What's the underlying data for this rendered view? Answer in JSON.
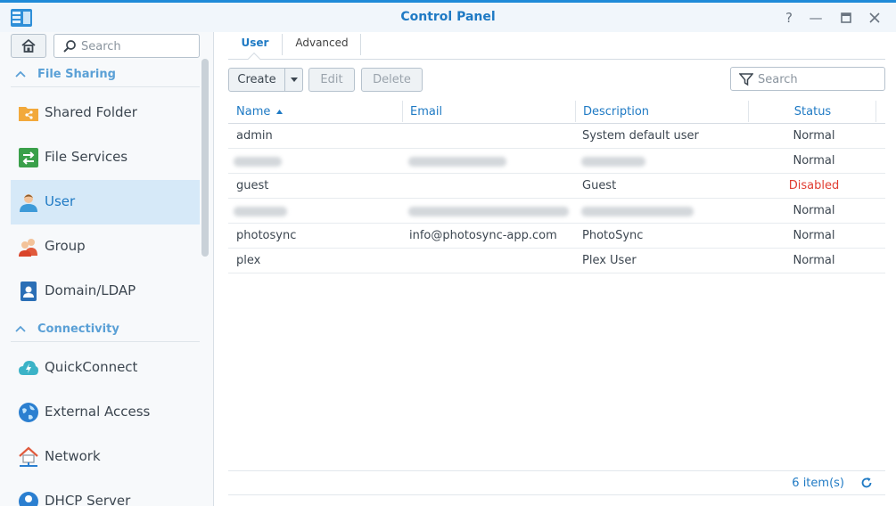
{
  "window": {
    "title": "Control Panel"
  },
  "sidebar": {
    "search_placeholder": "Search",
    "sections": [
      {
        "title": "File Sharing",
        "items": [
          {
            "label": "Shared Folder",
            "icon": "shared-folder-icon"
          },
          {
            "label": "File Services",
            "icon": "file-services-icon"
          },
          {
            "label": "User",
            "icon": "user-icon",
            "active": true
          },
          {
            "label": "Group",
            "icon": "group-icon"
          },
          {
            "label": "Domain/LDAP",
            "icon": "domain-ldap-icon"
          }
        ]
      },
      {
        "title": "Connectivity",
        "items": [
          {
            "label": "QuickConnect",
            "icon": "quickconnect-icon"
          },
          {
            "label": "External Access",
            "icon": "external-access-icon"
          },
          {
            "label": "Network",
            "icon": "network-icon"
          },
          {
            "label": "DHCP Server",
            "icon": "dhcp-server-icon"
          }
        ]
      }
    ]
  },
  "tabs": [
    {
      "label": "User",
      "active": true
    },
    {
      "label": "Advanced",
      "active": false
    }
  ],
  "toolbar": {
    "create_label": "Create",
    "edit_label": "Edit",
    "delete_label": "Delete",
    "search_placeholder": "Search"
  },
  "table": {
    "columns": [
      "Name",
      "Email",
      "Description",
      "Status"
    ],
    "sort_column": "Name",
    "sort_direction": "ascending",
    "rows": [
      {
        "name": "admin",
        "email": "",
        "description": "System default user",
        "status": "Normal"
      },
      {
        "name": "",
        "email": "",
        "description": "",
        "status": "Normal",
        "redacted": true
      },
      {
        "name": "guest",
        "email": "",
        "description": "Guest",
        "status": "Disabled"
      },
      {
        "name": "",
        "email": "",
        "description": "",
        "status": "Normal",
        "redacted": true
      },
      {
        "name": "photosync",
        "email": "info@photosync-app.com",
        "description": "PhotoSync",
        "status": "Normal"
      },
      {
        "name": "plex",
        "email": "",
        "description": "Plex User",
        "status": "Normal"
      }
    ]
  },
  "footer": {
    "count": "6 item(s)"
  },
  "colors": {
    "accent": "#1f7ac4",
    "disabled_status": "#e03c31",
    "active_nav_bg": "#d6e9f8"
  }
}
